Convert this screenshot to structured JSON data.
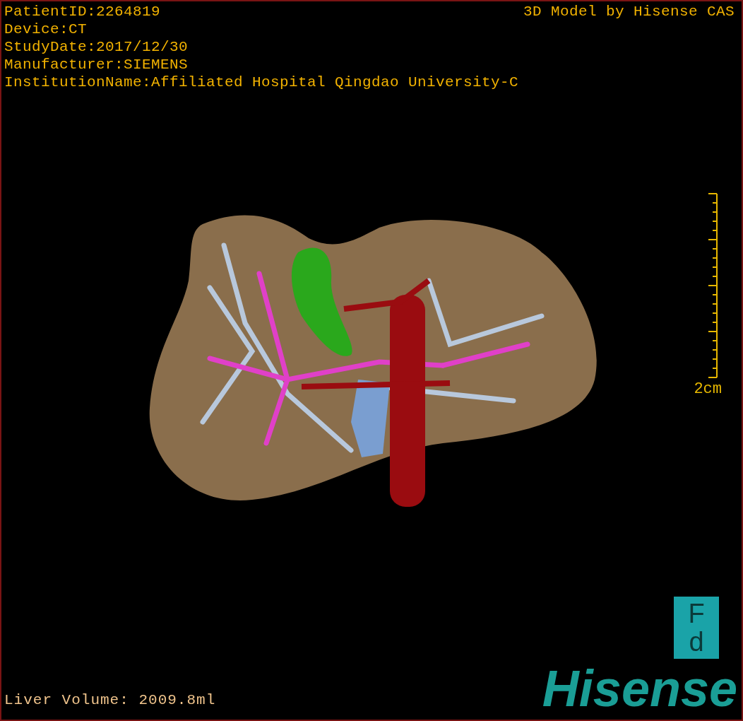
{
  "header": {
    "info_lines": [
      "PatientID:2264819",
      "Device:CT",
      "StudyDate:2017/12/30",
      "Manufacturer:SIEMENS",
      "InstitutionName:Affiliated Hospital Qingdao University-C"
    ],
    "title": "3D Model by Hisense CAS"
  },
  "scale": {
    "label": "2cm"
  },
  "orientation_marker": {
    "top": "F",
    "bottom": "d"
  },
  "footer": {
    "volume": "Liver Volume: 2009.8ml",
    "logo": "Hisense"
  }
}
